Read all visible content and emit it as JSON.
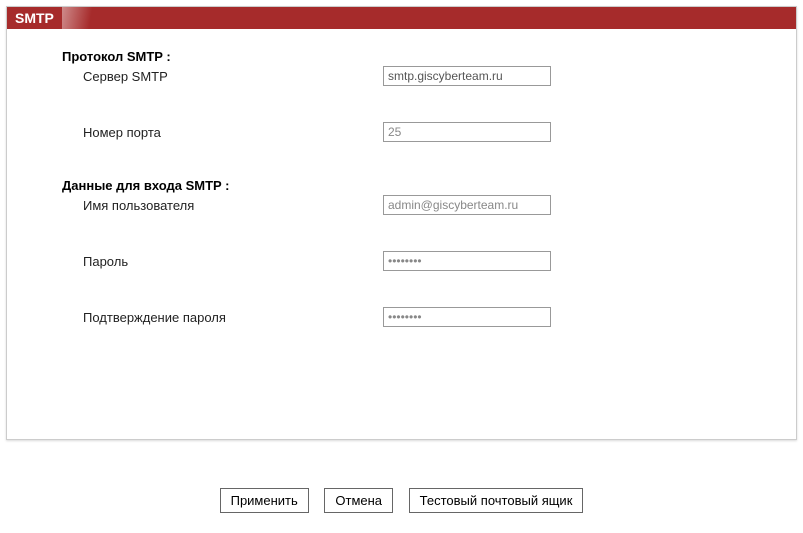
{
  "panel": {
    "title": "SMTP"
  },
  "section1": {
    "title": "Протокол SMTP :",
    "server_label": "Сервер SMTP",
    "server_value": "smtp.giscyberteam.ru",
    "port_label": "Номер порта",
    "port_value": "25"
  },
  "section2": {
    "title": "Данные для входа SMTP :",
    "username_label": "Имя пользователя",
    "username_value": "admin@giscyberteam.ru",
    "password_label": "Пароль",
    "password_value": "••••••••",
    "confirm_label": "Подтверждение пароля",
    "confirm_value": "••••••••"
  },
  "buttons": {
    "apply": "Применить",
    "cancel": "Отмена",
    "test": "Тестовый почтовый ящик"
  }
}
